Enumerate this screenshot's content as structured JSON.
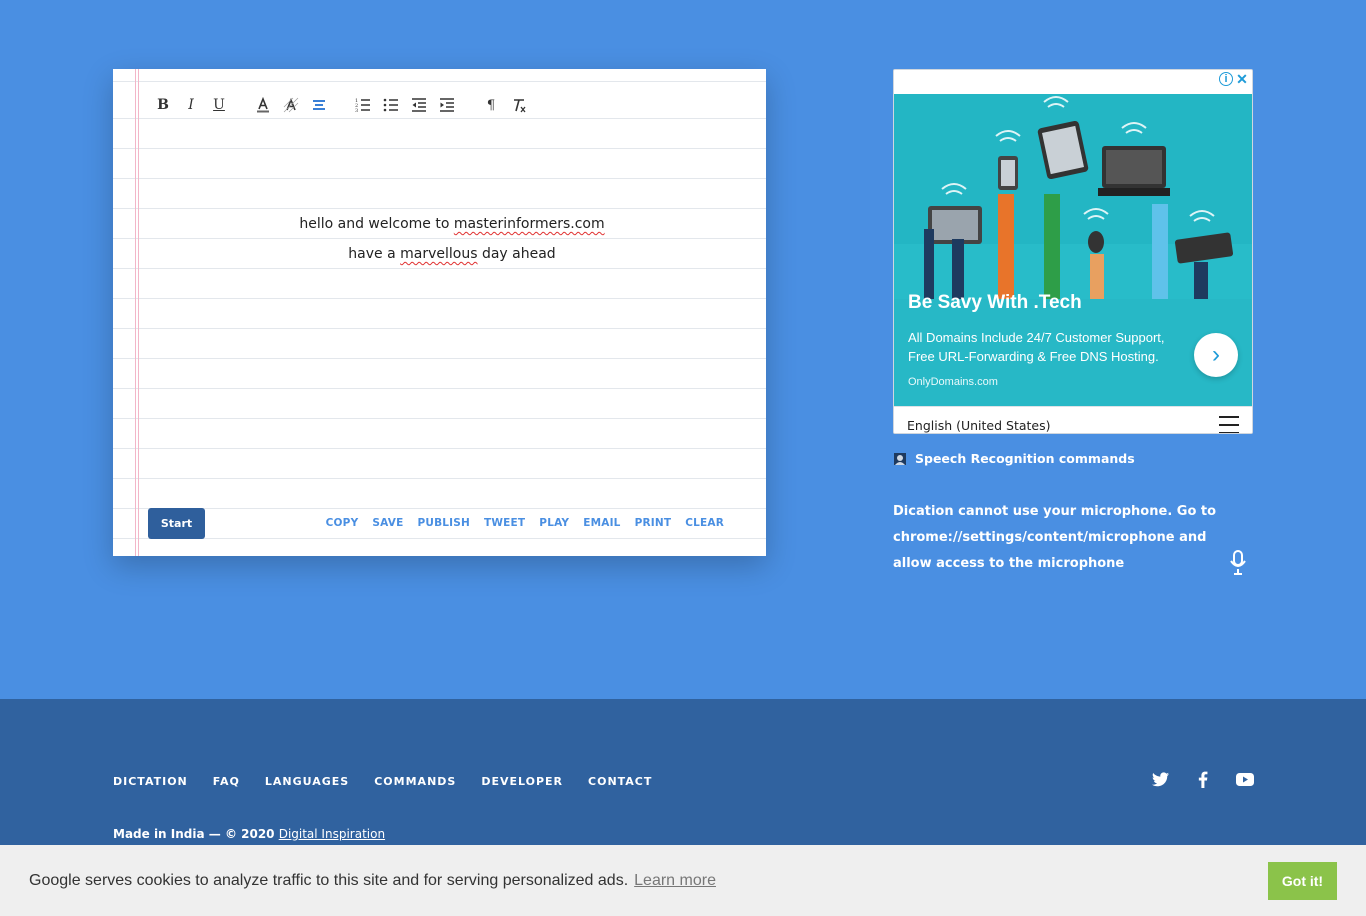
{
  "editor": {
    "toolbar": {
      "bold": "B",
      "italic": "I",
      "underline": "U",
      "paragraph": "¶"
    },
    "lines": [
      {
        "before": "hello and welcome to ",
        "marked": "masterinformers.com",
        "after": ""
      },
      {
        "before": "have a ",
        "marked": "marvellous",
        "after": " day ahead"
      }
    ],
    "start_label": "Start",
    "actions": [
      "COPY",
      "SAVE",
      "PUBLISH",
      "TWEET",
      "PLAY",
      "EMAIL",
      "PRINT",
      "CLEAR"
    ]
  },
  "ad": {
    "info": "i",
    "close": "✕",
    "title": "Be Savy With .Tech",
    "description": "All Domains Include 24/7 Customer Support, Free URL-Forwarding & Free DNS Hosting.",
    "domain": "OnlyDomains.com",
    "arrow": "›",
    "language": "English (United States)"
  },
  "sidebar": {
    "commands_link": "Speech Recognition commands",
    "notice": "Dication cannot use your microphone. Go to chrome://settings/content/microphone and allow access to the microphone"
  },
  "footer": {
    "nav": [
      "DICTATION",
      "FAQ",
      "LANGUAGES",
      "COMMANDS",
      "DEVELOPER",
      "CONTACT"
    ],
    "made_prefix": "Made in India — © 2020 ",
    "made_link": "Digital Inspiration",
    "social": [
      "twitter-icon",
      "facebook-icon",
      "youtube-icon"
    ]
  },
  "cookie": {
    "text": "Google serves cookies to analyze traffic to this site and for serving personalized ads.",
    "learn_more": "Learn more",
    "button": "Got it!"
  },
  "colors": {
    "background": "#4a8fe2",
    "footer": "#30629f",
    "accent_button": "#2f5f9c",
    "cookie_button": "#8bc34a",
    "ad_teal": "#23b6c4"
  }
}
